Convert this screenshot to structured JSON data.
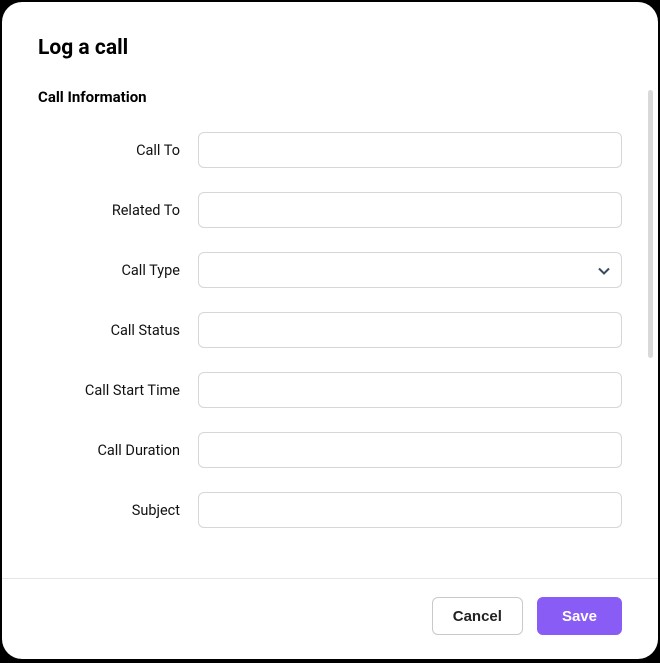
{
  "modal": {
    "title": "Log a call",
    "section_title": "Call Information",
    "fields": {
      "call_to": {
        "label": "Call To",
        "value": ""
      },
      "related_to": {
        "label": "Related To",
        "value": ""
      },
      "call_type": {
        "label": "Call Type",
        "value": ""
      },
      "call_status": {
        "label": "Call Status",
        "value": ""
      },
      "call_start_time": {
        "label": "Call Start Time",
        "value": ""
      },
      "call_duration": {
        "label": "Call Duration",
        "value": ""
      },
      "subject": {
        "label": "Subject",
        "value": ""
      }
    },
    "footer": {
      "cancel_label": "Cancel",
      "save_label": "Save"
    }
  }
}
